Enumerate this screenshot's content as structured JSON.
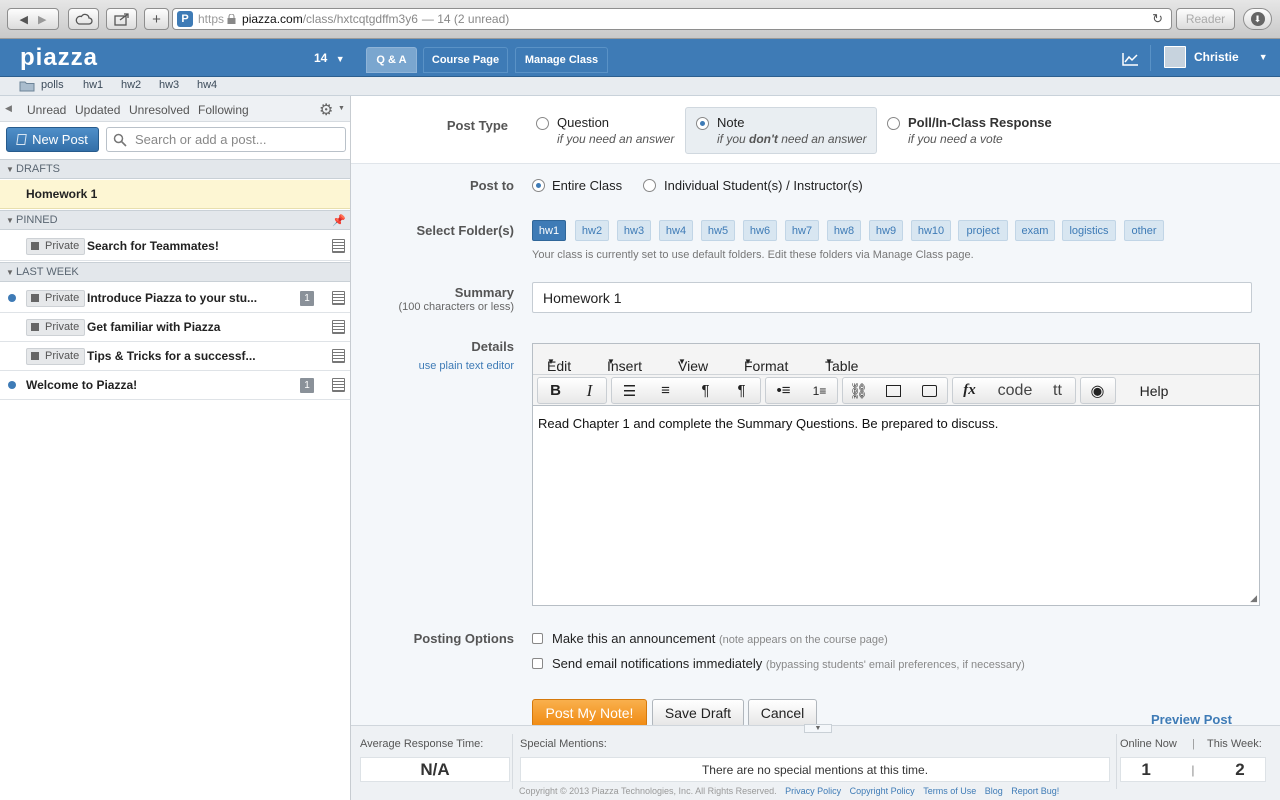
{
  "browser": {
    "scheme": "https",
    "host": "piazza.com",
    "path": "/class/hxtcqtgdffm3y6",
    "title_suffix": "— 14 (2 unread)",
    "reader": "Reader"
  },
  "topnav": {
    "logo": "piazza",
    "class_number": "14",
    "tabs": [
      "Q & A",
      "Course Page",
      "Manage Class"
    ],
    "active_tab": 0,
    "user": "Christie"
  },
  "folderbar": {
    "items": [
      "polls",
      "hw1",
      "hw2",
      "hw3",
      "hw4"
    ]
  },
  "sidebar": {
    "filters": [
      "Unread",
      "Updated",
      "Unresolved",
      "Following"
    ],
    "new_post": "New Post",
    "search_placeholder": "Search or add a post...",
    "sections": {
      "drafts": "DRAFTS",
      "pinned": "PINNED",
      "last_week": "LAST WEEK"
    },
    "draft": "Homework 1",
    "pinned_posts": [
      {
        "tag": "Private",
        "title": "Search for Teammates!"
      }
    ],
    "last_week_posts": [
      {
        "tag": "Private",
        "title": "Introduce Piazza to your stu...",
        "count": "1"
      },
      {
        "tag": "Private",
        "title": "Get familiar with Piazza"
      },
      {
        "tag": "Private",
        "title": "Tips & Tricks for a successf..."
      },
      {
        "title": "Welcome to Piazza!",
        "count": "1"
      }
    ]
  },
  "form": {
    "post_type_label": "Post Type",
    "types": [
      {
        "title": "Question",
        "sub": "if you need an answer"
      },
      {
        "title": "Note",
        "sub_pre": "if you ",
        "sub_em": "don't",
        "sub_post": " need an answer"
      },
      {
        "title": "Poll/In-Class Response",
        "sub": "if you need a vote"
      }
    ],
    "post_to_label": "Post to",
    "post_to": [
      "Entire Class",
      "Individual Student(s) / Instructor(s)"
    ],
    "folders_label": "Select Folder(s)",
    "folders": [
      "hw1",
      "hw2",
      "hw3",
      "hw4",
      "hw5",
      "hw6",
      "hw7",
      "hw8",
      "hw9",
      "hw10",
      "project",
      "exam",
      "logistics",
      "other"
    ],
    "folders_note": "Your class is currently set to use default folders. Edit these folders via Manage Class page.",
    "summary_label": "Summary",
    "summary_hint": "(100 characters or less)",
    "summary_value": "Homework 1",
    "details_label": "Details",
    "plain_editor_link": "use plain text editor",
    "editor_menus": [
      "Edit",
      "Insert",
      "View",
      "Format",
      "Table"
    ],
    "editor_code": "code",
    "editor_tt": "tt",
    "editor_help": "Help",
    "editor_text": "Read Chapter 1 and complete the Summary Questions. Be prepared to discuss.",
    "posting_options_label": "Posting Options",
    "opt1": "Make this an announcement",
    "opt1_note": "(note appears on the course page)",
    "opt2": "Send email notifications immediately",
    "opt2_note": "(bypassing students' email preferences, if necessary)",
    "post_button": "Post My Note!",
    "save_button": "Save Draft",
    "cancel_button": "Cancel",
    "preview": "Preview Post"
  },
  "footer": {
    "avg_label": "Average Response Time:",
    "avg_value": "N/A",
    "mentions_label": "Special Mentions:",
    "mentions_value": "There are no special mentions at this time.",
    "online_label": "Online Now",
    "week_label": "This Week:",
    "online_value": "1",
    "week_value": "2",
    "separator": "|",
    "copyright": "Copyright © 2013 Piazza Technologies, Inc. All Rights Reserved.",
    "links": [
      "Privacy Policy",
      "Copyright Policy",
      "Terms of Use",
      "Blog",
      "Report Bug!"
    ]
  }
}
